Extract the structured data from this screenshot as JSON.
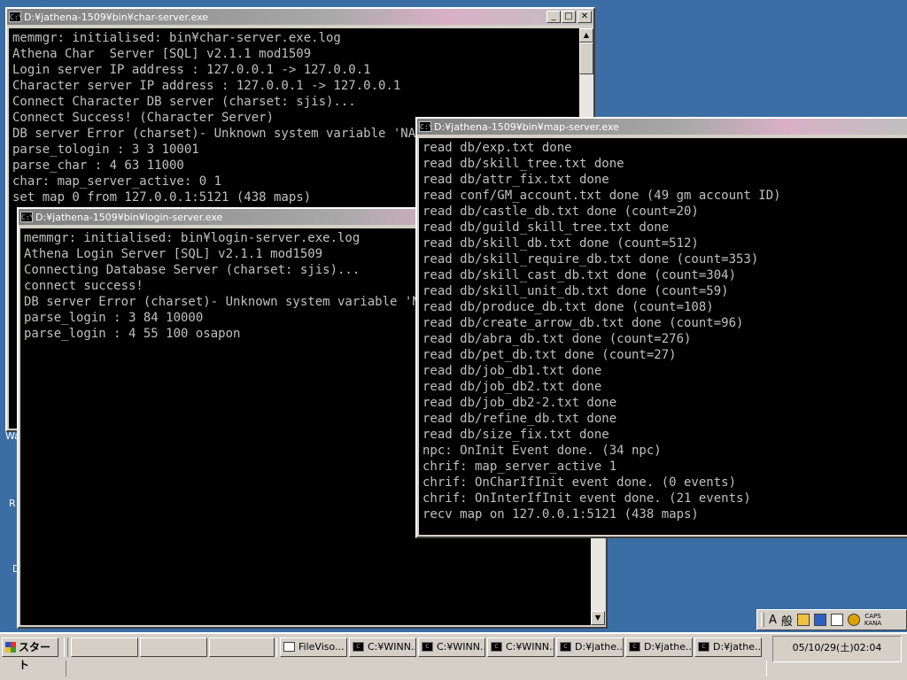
{
  "desktop": {
    "labels": [
      "Wa",
      "R",
      "D"
    ]
  },
  "char_window": {
    "title": "D:¥jathena-1509¥bin¥char-server.exe",
    "lines": [
      "memmgr: initialised: bin¥char-server.exe.log",
      "Athena Char  Server [SQL] v2.1.1 mod1509",
      "Login server IP address : 127.0.0.1 -> 127.0.0.1",
      "Character server IP address : 127.0.0.1 -> 127.0.0.1",
      "Connect Character DB server (charset: sjis)...",
      "Connect Success! (Character Server)",
      "DB server Error (charset)- Unknown system variable 'NAMES'",
      "parse_tologin : 3 3 10001",
      "parse_char : 4 63 11000",
      "char: map_server_active: 0 1",
      "set map 0 from 127.0.0.1:5121 (438 maps)"
    ]
  },
  "login_window": {
    "title": "D:¥jathena-1509¥bin¥login-server.exe",
    "lines": [
      "memmgr: initialised: bin¥login-server.exe.log",
      "Athena Login Server [SQL] v2.1.1 mod1509",
      "Connecting Database Server (charset: sjis)...",
      "connect success!",
      "DB server Error (charset)- Unknown system variable 'NAMES'",
      "parse_login : 3 84 10000",
      "parse_login : 4 55 100 osapon"
    ]
  },
  "map_window": {
    "title": "D:¥jathena-1509¥bin¥map-server.exe",
    "lines": [
      "read db/exp.txt done",
      "read db/skill_tree.txt done",
      "read db/attr_fix.txt done",
      "read conf/GM_account.txt done (49 gm account ID)",
      "read db/castle_db.txt done (count=20)",
      "read db/guild_skill_tree.txt done",
      "read db/skill_db.txt done (count=512)",
      "read db/skill_require_db.txt done (count=353)",
      "read db/skill_cast_db.txt done (count=304)",
      "read db/skill_unit_db.txt done (count=59)",
      "read db/produce_db.txt done (count=108)",
      "read db/create_arrow_db.txt done (count=96)",
      "read db/abra_db.txt done (count=276)",
      "read db/pet_db.txt done (count=27)",
      "read db/job_db1.txt done",
      "read db/job_db2.txt done",
      "read db/job_db2-2.txt done",
      "read db/refine_db.txt done",
      "read db/size_fix.txt done",
      "npc: OnInit Event done. (34 npc)",
      "chrif: map_server_active 1",
      "chrif: OnCharIfInit event done. (0 events)",
      "chrif: OnInterIfInit event done. (21 events)",
      "recv map on 127.0.0.1:5121 (438 maps)"
    ]
  },
  "taskbar": {
    "start_label": "スタート",
    "buttons": [
      {
        "label": "FileViso...",
        "icon": "document-icon"
      },
      {
        "label": "C:¥WINN...",
        "icon": "console-icon"
      },
      {
        "label": "C:¥WINN...",
        "icon": "console-icon"
      },
      {
        "label": "C:¥WINN...",
        "icon": "console-icon"
      },
      {
        "label": "D:¥jathe...",
        "icon": "console-icon"
      },
      {
        "label": "D:¥jathe...",
        "icon": "console-icon"
      },
      {
        "label": "D:¥jathe...",
        "icon": "console-icon"
      }
    ],
    "clock": "05/10/29(土)02:04"
  },
  "ime_bar": {
    "mode": "A",
    "kanji": "般",
    "caps_top": "CAPS",
    "caps_bottom": "KANA"
  }
}
